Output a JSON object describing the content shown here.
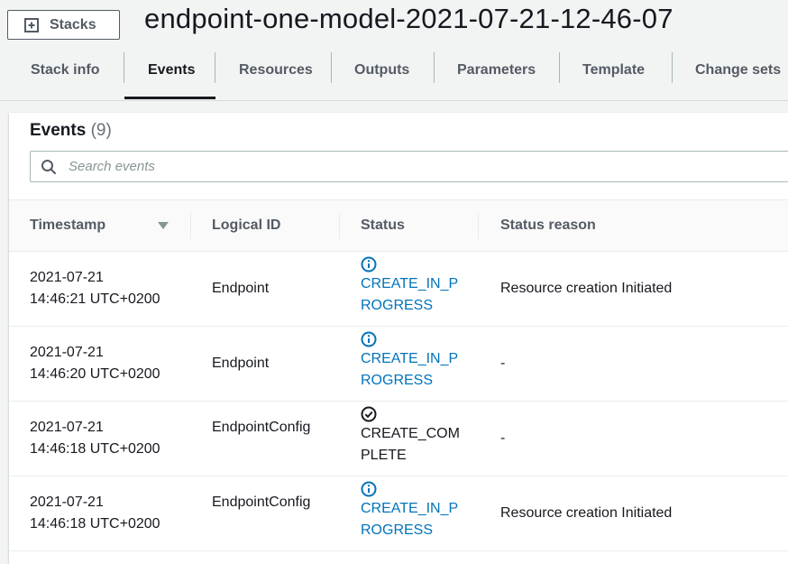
{
  "header": {
    "stacks_label": "Stacks",
    "title": "endpoint-one-model-2021-07-21-12-46-07"
  },
  "tabs": [
    {
      "label": "Stack info"
    },
    {
      "label": "Events"
    },
    {
      "label": "Resources"
    },
    {
      "label": "Outputs"
    },
    {
      "label": "Parameters"
    },
    {
      "label": "Template"
    },
    {
      "label": "Change sets"
    }
  ],
  "active_tab": "Events",
  "events": {
    "title": "Events",
    "count": "(9)",
    "search_placeholder": "Search events",
    "columns": {
      "timestamp": "Timestamp",
      "logical_id": "Logical ID",
      "status": "Status",
      "status_reason": "Status reason"
    },
    "rows": [
      {
        "timestamp_date": "2021-07-21",
        "timestamp_time": "14:46:21 UTC+0200",
        "logical_id": "Endpoint",
        "status": "CREATE_IN_PROGRESS",
        "status_icon": "info-icon",
        "status_reason": "Resource creation Initiated"
      },
      {
        "timestamp_date": "2021-07-21",
        "timestamp_time": "14:46:20 UTC+0200",
        "logical_id": "Endpoint",
        "status": "CREATE_IN_PROGRESS",
        "status_icon": "info-icon",
        "status_reason": "-"
      },
      {
        "timestamp_date": "2021-07-21",
        "timestamp_time": "14:46:18 UTC+0200",
        "logical_id": "EndpointConfig",
        "status": "CREATE_COMPLETE",
        "status_icon": "check-circle-icon",
        "status_reason": "-"
      },
      {
        "timestamp_date": "2021-07-21",
        "timestamp_time": "14:46:18 UTC+0200",
        "logical_id": "EndpointConfig",
        "status": "CREATE_IN_PROGRESS",
        "status_icon": "info-icon",
        "status_reason": "Resource creation Initiated"
      }
    ]
  },
  "colors": {
    "link_blue": "#0073bb",
    "text_dark": "#16191f",
    "text_gray": "#545b64",
    "page_bg": "#f2f3f3"
  }
}
